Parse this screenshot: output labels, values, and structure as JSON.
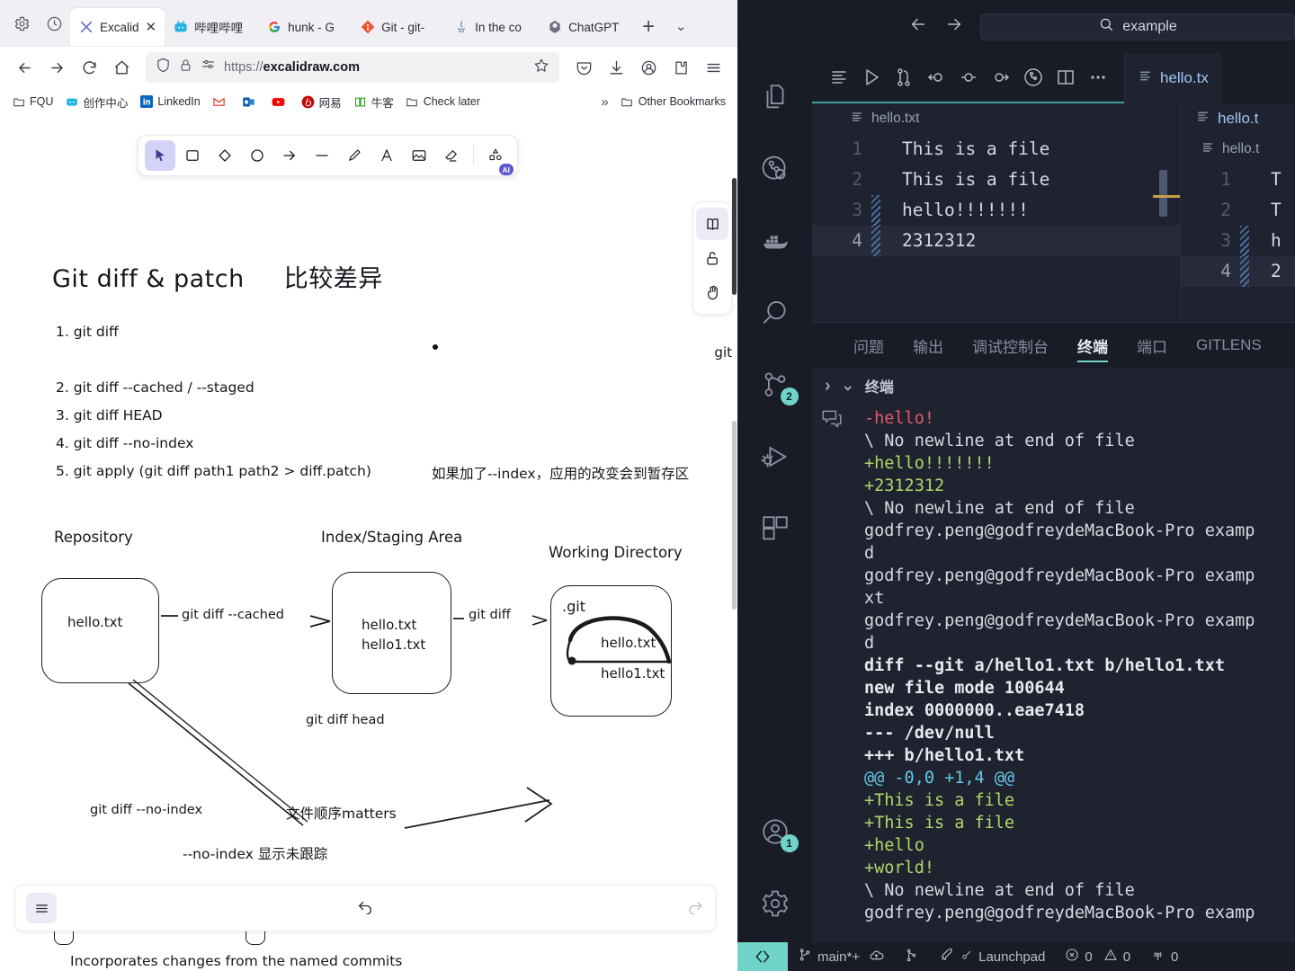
{
  "browser": {
    "tabs": [
      {
        "label": "Excalid",
        "icon": "excalidraw-icon",
        "active": true,
        "closable": true
      },
      {
        "label": "哔哩哔哩",
        "icon": "bilibili-icon",
        "active": false
      },
      {
        "label": "hunk - G",
        "icon": "google-icon",
        "active": false
      },
      {
        "label": "Git - git-",
        "icon": "git-icon",
        "active": false
      },
      {
        "label": "In the co",
        "icon": "java-icon",
        "active": false
      },
      {
        "label": "ChatGPT",
        "icon": "openai-icon",
        "active": false
      }
    ],
    "new_tab_label": "+",
    "tab_list_label": "⌄",
    "url_prefix": "https://",
    "url_domain": "excalidraw.com",
    "bookmarks": [
      {
        "label": "FQU",
        "icon": "folder-icon"
      },
      {
        "label": "创作中心",
        "icon": "bilibili-icon"
      },
      {
        "label": "LinkedIn",
        "icon": "linkedin-icon"
      },
      {
        "label": "",
        "icon": "gmail-icon"
      },
      {
        "label": "",
        "icon": "outlook-icon"
      },
      {
        "label": "",
        "icon": "youtube-icon"
      },
      {
        "label": "网易",
        "icon": "netease-icon"
      },
      {
        "label": "牛客",
        "icon": "nowcoder-icon"
      },
      {
        "label": "Check later",
        "icon": "folder-icon"
      }
    ],
    "bookmarks_overflow": "»",
    "other_bookmarks": "Other Bookmarks"
  },
  "excalidraw": {
    "tools": [
      {
        "name": "selection-tool",
        "glyph": "arrow",
        "selected": true
      },
      {
        "name": "rectangle-tool",
        "glyph": "square",
        "selected": false
      },
      {
        "name": "diamond-tool",
        "glyph": "diamond",
        "selected": false
      },
      {
        "name": "ellipse-tool",
        "glyph": "circle",
        "selected": false
      },
      {
        "name": "arrow-tool",
        "glyph": "arrow-right",
        "selected": false
      },
      {
        "name": "line-tool",
        "glyph": "line",
        "selected": false
      },
      {
        "name": "draw-tool",
        "glyph": "pencil",
        "selected": false
      },
      {
        "name": "text-tool",
        "glyph": "letter-a",
        "selected": false
      },
      {
        "name": "image-tool",
        "glyph": "image",
        "selected": false
      },
      {
        "name": "eraser-tool",
        "glyph": "eraser",
        "selected": false
      },
      {
        "name": "shapes-ai-tool",
        "glyph": "shapes",
        "selected": false,
        "badge": "AI"
      }
    ],
    "right_buttons": [
      {
        "name": "library-button",
        "glyph": "book",
        "selected": true
      },
      {
        "name": "lock-button",
        "glyph": "unlock",
        "selected": false
      },
      {
        "name": "hand-button",
        "glyph": "hand",
        "selected": false
      }
    ],
    "footer": {
      "menu": "hamburger-icon",
      "undo": "undo-icon",
      "redo": "redo-icon"
    },
    "title_en": "Git diff & patch",
    "title_cn": "比较差异",
    "list": [
      "1. git diff",
      "2. git diff --cached / --staged",
      "3. git diff HEAD",
      "4. git diff --no-index",
      "5. git apply (git diff path1 path2  > diff.patch)"
    ],
    "note_index": "如果加了--index，应用的改变会到暂存区",
    "edge_text": "git",
    "diagram": {
      "col_labels": [
        "Repository",
        "Index/Staging Area",
        "Working Directory"
      ],
      "repo_files": [
        "hello.txt"
      ],
      "index_files": [
        "hello.txt",
        "hello1.txt"
      ],
      "wd_dotgit": ".git",
      "wd_files": [
        "hello.txt",
        "hello1.txt"
      ],
      "arrow_cached": "git diff --cached",
      "arrow_diff": "git diff",
      "arrow_head": "git diff head"
    },
    "noindex": {
      "arrow": "git diff --no-index",
      "note": "文件顺序matters",
      "caption": "--no-index 显示未跟踪"
    },
    "bottom_text": "Incorporates changes from the named commits"
  },
  "vscode": {
    "titlebar": {
      "back": "back-arrow-icon",
      "forward": "forward-arrow-icon",
      "search_text": "example",
      "search_icon": "search-icon"
    },
    "activity_items": [
      {
        "name": "explorer-icon",
        "badge": ""
      },
      {
        "name": "gitlens-icon",
        "badge": ""
      },
      {
        "name": "docker-icon",
        "badge": ""
      },
      {
        "name": "search-icon",
        "badge": ""
      },
      {
        "name": "source-control-icon",
        "badge": "2"
      },
      {
        "name": "run-debug-icon",
        "badge": ""
      },
      {
        "name": "extensions-icon",
        "badge": ""
      }
    ],
    "activity_bottom": [
      {
        "name": "accounts-icon",
        "badge": "1"
      },
      {
        "name": "settings-gear-icon",
        "badge": ""
      }
    ],
    "editor_toolbar": [
      "open-changes-icon",
      "run-icon",
      "compare-branch-icon",
      "previous-change-icon",
      "current-change-icon",
      "next-change-icon",
      "blame-icon",
      "split-editor-icon",
      "more-actions-icon"
    ],
    "editor_tabs": [
      {
        "label": "hello.tx",
        "active": true
      },
      {
        "label": "hello.t",
        "active": false
      }
    ],
    "panes": [
      {
        "title": "hello.txt",
        "lines": [
          {
            "n": "1",
            "text": "This is a file",
            "modified": false,
            "current": false
          },
          {
            "n": "2",
            "text": "This is a file",
            "modified": false,
            "current": false
          },
          {
            "n": "3",
            "text": "hello!!!!!!!",
            "modified": true,
            "current": false
          },
          {
            "n": "4",
            "text": "2312312",
            "modified": true,
            "current": true
          }
        ]
      },
      {
        "title": "hello.t",
        "lines": [
          {
            "n": "1",
            "text": "T",
            "modified": false,
            "current": false
          },
          {
            "n": "2",
            "text": "T",
            "modified": false,
            "current": false
          },
          {
            "n": "3",
            "text": "h",
            "modified": true,
            "current": false
          },
          {
            "n": "4",
            "text": "2",
            "modified": true,
            "current": true
          }
        ]
      }
    ],
    "panel_tabs": [
      {
        "label": "问题",
        "active": false
      },
      {
        "label": "输出",
        "active": false
      },
      {
        "label": "调试控制台",
        "active": false
      },
      {
        "label": "终端",
        "active": true
      },
      {
        "label": "端口",
        "active": false
      },
      {
        "label": "GITLENS",
        "active": false
      }
    ],
    "terminal_header": {
      "expand": "chevron-right-icon",
      "collapse": "chevron-down-icon",
      "title": "终端",
      "new_terminal": "new-terminal-icon"
    },
    "terminal_lines": [
      {
        "text": "-hello!",
        "style": "red",
        "bullet": ""
      },
      {
        "text": "\\ No newline at end of file",
        "style": "white",
        "bullet": ""
      },
      {
        "text": "+hello!!!!!!!",
        "style": "green",
        "bullet": ""
      },
      {
        "text": "+2312312",
        "style": "green",
        "bullet": ""
      },
      {
        "text": "\\ No newline at end of file",
        "style": "white",
        "bullet": ""
      },
      {
        "text": "godfrey.peng@godfreydeMacBook-Pro examp",
        "style": "white",
        "bullet": "filled"
      },
      {
        "text": "d",
        "style": "white",
        "bullet": ""
      },
      {
        "text": "godfrey.peng@godfreydeMacBook-Pro examp",
        "style": "white",
        "bullet": "filled"
      },
      {
        "text": "xt",
        "style": "white",
        "bullet": ""
      },
      {
        "text": "godfrey.peng@godfreydeMacBook-Pro examp",
        "style": "white",
        "bullet": "filled"
      },
      {
        "text": "d",
        "style": "white",
        "bullet": ""
      },
      {
        "text": "diff --git a/hello1.txt b/hello1.txt",
        "style": "bold",
        "bullet": ""
      },
      {
        "text": "new file mode 100644",
        "style": "bold",
        "bullet": ""
      },
      {
        "text": "index 0000000..eae7418",
        "style": "bold",
        "bullet": ""
      },
      {
        "text": "--- /dev/null",
        "style": "bold",
        "bullet": ""
      },
      {
        "text": "+++ b/hello1.txt",
        "style": "bold",
        "bullet": ""
      },
      {
        "text": "@@ -0,0 +1,4 @@",
        "style": "cyan",
        "bullet": ""
      },
      {
        "text": "+This is a file",
        "style": "green",
        "bullet": ""
      },
      {
        "text": "+This is a file",
        "style": "green",
        "bullet": ""
      },
      {
        "text": "+hello",
        "style": "green",
        "bullet": ""
      },
      {
        "text": "+world!",
        "style": "green",
        "bullet": ""
      },
      {
        "text": "\\ No newline at end of file",
        "style": "white",
        "bullet": ""
      },
      {
        "text": "godfrey.peng@godfreydeMacBook-Pro examp",
        "style": "white",
        "bullet": "hollow"
      }
    ],
    "statusbar": {
      "remote_icon": "remote-window-icon",
      "branch": "main*+",
      "sync_icon": "cloud-sync-icon",
      "gitlens_icon": "gitlens-graph-icon",
      "launchpad": "Launchpad",
      "errors": "0",
      "warnings": "0",
      "ports": "0"
    },
    "accent_color": "#6fd3c7"
  }
}
